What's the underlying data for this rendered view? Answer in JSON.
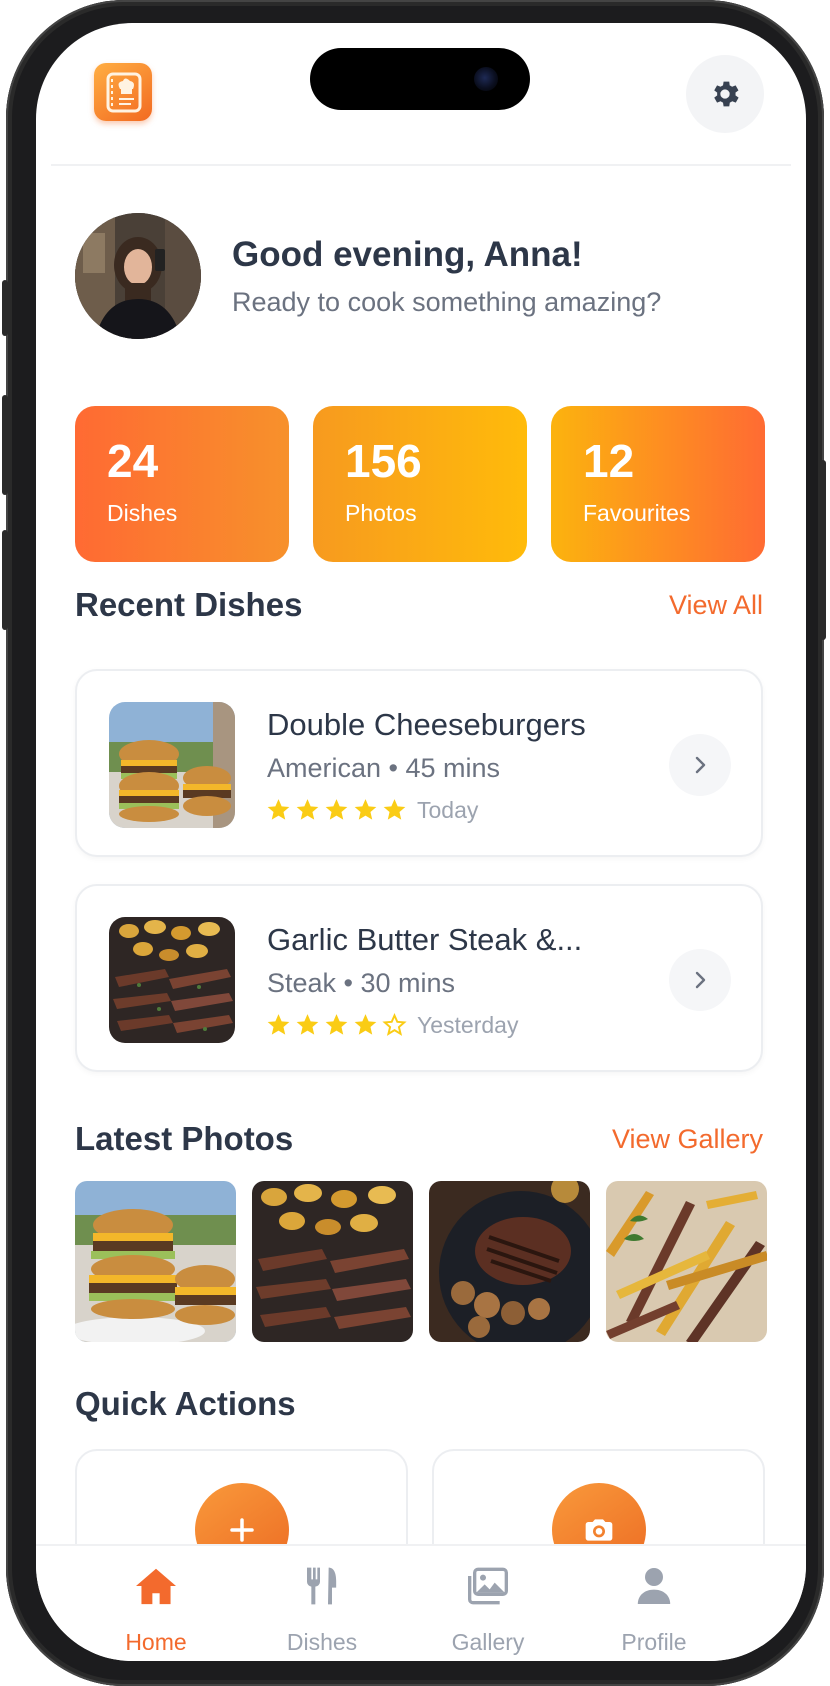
{
  "colors": {
    "accent": "#f36a2d",
    "text_dark": "#2d3748",
    "text_muted": "#6b7280",
    "star": "#facc15"
  },
  "header": {
    "logo_icon": "chef-book-icon",
    "settings_icon": "gear-icon"
  },
  "greeting": {
    "title": "Good evening, Anna!",
    "subtitle": "Ready to cook something amazing?"
  },
  "stats": [
    {
      "value": "24",
      "label": "Dishes"
    },
    {
      "value": "156",
      "label": "Photos"
    },
    {
      "value": "12",
      "label": "Favourites"
    }
  ],
  "recent": {
    "title": "Recent Dishes",
    "link": "View All",
    "dishes": [
      {
        "name": "Double Cheeseburgers",
        "meta": "American • 45 mins",
        "rating": 5,
        "date": "Today"
      },
      {
        "name": "Garlic Butter Steak &...",
        "meta": "Steak • 30 mins",
        "rating": 4,
        "date": "Yesterday"
      }
    ]
  },
  "photos": {
    "title": "Latest Photos",
    "link": "View Gallery"
  },
  "quick_actions": {
    "title": "Quick Actions",
    "actions": [
      {
        "icon": "plus-icon"
      },
      {
        "icon": "camera-icon"
      }
    ]
  },
  "nav": {
    "items": [
      {
        "label": "Home",
        "icon": "home-icon",
        "active": true
      },
      {
        "label": "Dishes",
        "icon": "utensils-icon",
        "active": false
      },
      {
        "label": "Gallery",
        "icon": "images-icon",
        "active": false
      },
      {
        "label": "Profile",
        "icon": "user-icon",
        "active": false
      }
    ]
  }
}
